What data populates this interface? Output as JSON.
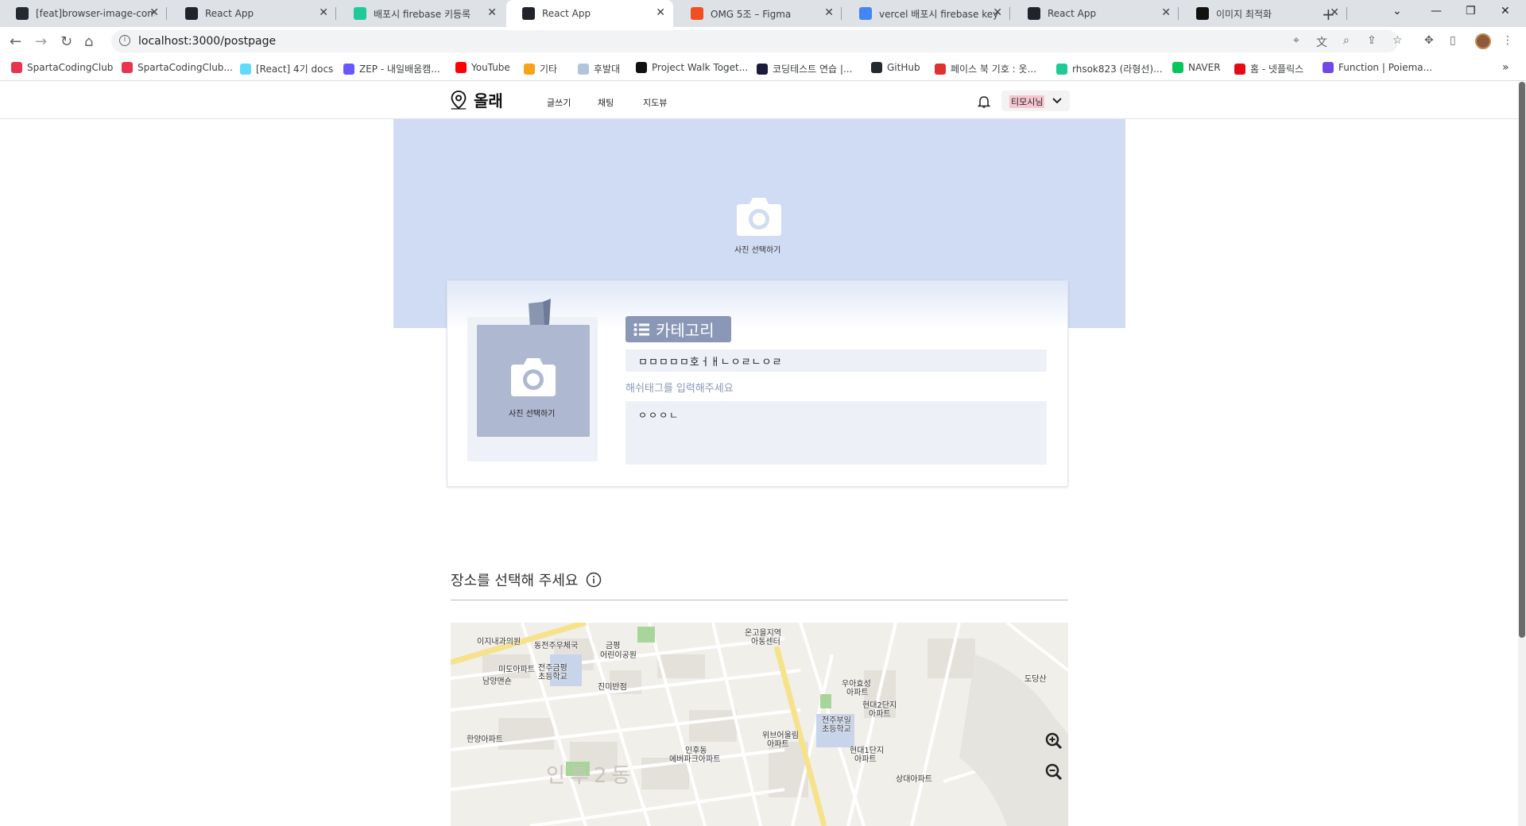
{
  "browser": {
    "tabs": [
      {
        "title": "[feat]browser-image-comp",
        "icon": "github-icon",
        "color": "#24292f"
      },
      {
        "title": "React App",
        "icon": "react-icon",
        "color": "#20232a"
      },
      {
        "title": "배포시 firebase 키등록",
        "icon": "velog-icon",
        "color": "#20c997"
      },
      {
        "title": "React App",
        "icon": "react-icon",
        "color": "#20232a",
        "active": true
      },
      {
        "title": "OMG 5조 – Figma",
        "icon": "figma-icon",
        "color": "#f24e1e"
      },
      {
        "title": "vercel 배포시 firebase key",
        "icon": "google-icon",
        "color": "#4285f4"
      },
      {
        "title": "React App",
        "icon": "react-icon",
        "color": "#20232a"
      },
      {
        "title": "이미지 최적화",
        "icon": "notion-icon",
        "color": "#111111"
      }
    ],
    "url": "localhost:3000/postpage",
    "bookmarks": [
      {
        "label": "SpartaCodingClub",
        "color": "#e8344e"
      },
      {
        "label": "SpartaCodingClub...",
        "color": "#e8344e"
      },
      {
        "label": "[React] 4기 docs",
        "color": "#61dafb"
      },
      {
        "label": "ZEP - 내일배움캠...",
        "color": "#6758ff"
      },
      {
        "label": "YouTube",
        "color": "#ff0000"
      },
      {
        "label": "기타",
        "color": "#f7a21b"
      },
      {
        "label": "후발대",
        "color": "#b0c4de"
      },
      {
        "label": "Project Walk Toget...",
        "color": "#111111"
      },
      {
        "label": "코딩테스트 연습 |...",
        "color": "#1b1b3a"
      },
      {
        "label": "GitHub",
        "color": "#24292f"
      },
      {
        "label": "페이스 북 기호 : 옷...",
        "color": "#e03131"
      },
      {
        "label": "rhsok823 (라형선)...",
        "color": "#20c997"
      },
      {
        "label": "NAVER",
        "color": "#03c75a"
      },
      {
        "label": "홈 - 넷플릭스",
        "color": "#e50914"
      },
      {
        "label": "Function | Poiema...",
        "color": "#7048e8"
      }
    ]
  },
  "header": {
    "brand": "올래",
    "menu": [
      "글쓰기",
      "채팅",
      "지도뷰"
    ],
    "user": "티모시님"
  },
  "post": {
    "cover_label": "사진 선택하기",
    "photo_label": "사진 선택하기",
    "category": "카테고리",
    "title_value": "ㅁㅁㅁㅁㅁ호ㅓㅐㄴㅇㄹㄴㅇㄹ",
    "hashtag_hint": "해쉬태그를 입력해주세요",
    "body_value": "ㅇㅇㅇㄴ",
    "place_title": "장소를 선택해 주세요"
  },
  "map": {
    "labels": [
      {
        "text": "이지내과의원",
        "cls": "l1"
      },
      {
        "text": "동전주우체국",
        "cls": "l2"
      },
      {
        "text": "금평",
        "cls": "l3"
      },
      {
        "text": "어린이공원",
        "cls": "l4"
      },
      {
        "text": "온고을지역",
        "cls": "l5"
      },
      {
        "text": "아동센터",
        "cls": "l6"
      },
      {
        "text": "미도아파트",
        "cls": "l7"
      },
      {
        "text": "전주금평",
        "cls": "l8"
      },
      {
        "text": "초등학교",
        "cls": "l9"
      },
      {
        "text": "남양맨숀",
        "cls": "l10"
      },
      {
        "text": "진미반점",
        "cls": "l11"
      },
      {
        "text": "우아효성",
        "cls": "l12"
      },
      {
        "text": "아파트",
        "cls": "l13"
      },
      {
        "text": "도당산",
        "cls": "l14"
      },
      {
        "text": "현대2단지",
        "cls": "l15"
      },
      {
        "text": "아파트",
        "cls": "l16"
      },
      {
        "text": "전주부일",
        "cls": "l17"
      },
      {
        "text": "초등학교",
        "cls": "l18"
      },
      {
        "text": "한양아파트",
        "cls": "l19"
      },
      {
        "text": "위브어울림",
        "cls": "l20"
      },
      {
        "text": "아파트",
        "cls": "l21"
      },
      {
        "text": "인후동",
        "cls": "l22"
      },
      {
        "text": "에버파크아파트",
        "cls": "l23"
      },
      {
        "text": "현대1단지",
        "cls": "l24"
      },
      {
        "text": "아파트",
        "cls": "l25"
      },
      {
        "text": "상대아파트",
        "cls": "l26"
      }
    ],
    "district": "인후2동"
  }
}
